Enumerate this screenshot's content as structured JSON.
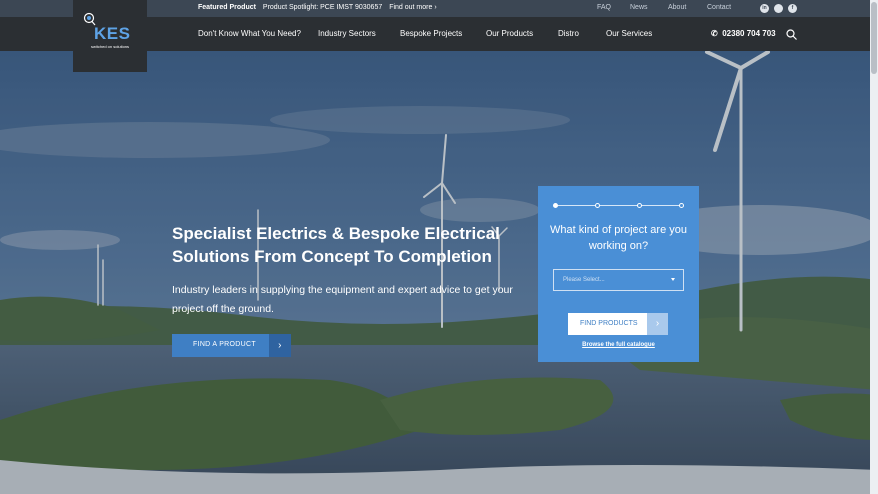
{
  "topbar": {
    "featured_label": "Featured Product",
    "spotlight_text": "Product Spotlight: PCE IMST 9030657",
    "find_out_more": "Find out more",
    "links": [
      "FAQ",
      "News",
      "About",
      "Contact"
    ],
    "social": [
      {
        "icon": "linkedin-icon",
        "glyph": "in"
      },
      {
        "icon": "twitter-icon",
        "glyph": ""
      },
      {
        "icon": "facebook-icon",
        "glyph": "f"
      }
    ]
  },
  "logo": {
    "text": "KES",
    "tagline": "switched on solutions"
  },
  "nav": {
    "items": [
      "Don't Know What You Need?",
      "Industry Sectors",
      "Bespoke Projects",
      "Our Products",
      "Distro",
      "Our Services"
    ],
    "phone": "02380 704 703"
  },
  "hero": {
    "headline_line1": "Specialist Electrics & Bespoke Electrical",
    "headline_line2": "Solutions From Concept To Completion",
    "subtext": "Industry leaders in supplying the equipment and expert advice to get your project off the ground.",
    "cta_label": "FIND A PRODUCT"
  },
  "panel": {
    "question": "What kind of project are you working on?",
    "select_placeholder": "Please Select...",
    "button_label": "FIND PRODUCTS",
    "link_text": "Browse the full catalogue",
    "steps_total": 4,
    "steps_active": 1
  },
  "colors": {
    "accent": "#4a8fd6",
    "nav_bg": "#2b2f33",
    "topbar_bg": "#3c4754",
    "button_blue": "#3f7fc4"
  }
}
